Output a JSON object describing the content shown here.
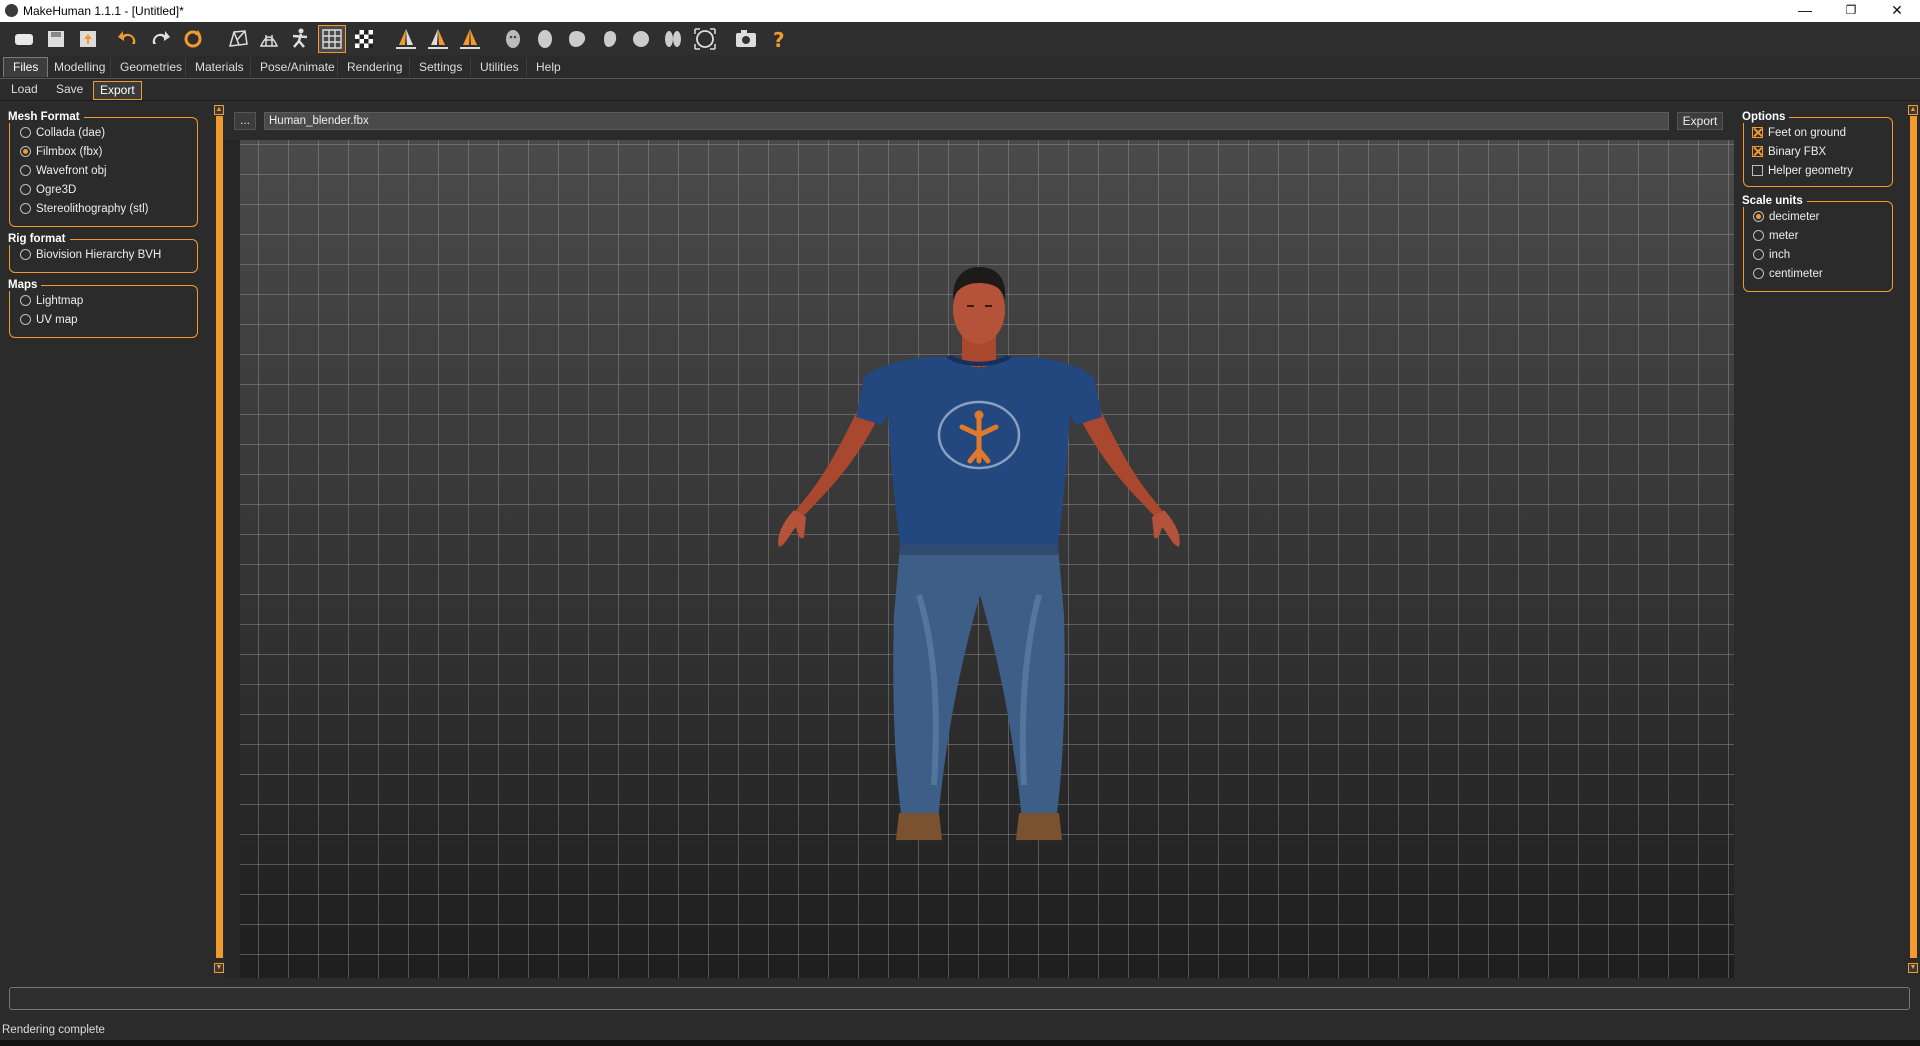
{
  "window": {
    "title": "MakeHuman 1.1.1 - [Untitled]*",
    "minimize": "—",
    "maximize": "❐",
    "close": "✕"
  },
  "toolbar": {
    "icons": [
      "new-file-icon",
      "save-file-icon",
      "export-file-icon",
      "undo-icon",
      "redo-icon",
      "reset-icon",
      "wireframe-icon",
      "smooth-icon",
      "pose-icon",
      "grid-icon",
      "checker-background-icon",
      "front-view-icon",
      "back-view-icon",
      "left-view-icon",
      "right-view-icon",
      "top-view-icon",
      "bottom-view-icon",
      "reset-camera-icon",
      "screenshot-icon",
      "help-icon"
    ]
  },
  "tabs": [
    "Files",
    "Modelling",
    "Geometries",
    "Materials",
    "Pose/Animate",
    "Rendering",
    "Settings",
    "Utilities",
    "Help"
  ],
  "subtabs": [
    "Load",
    "Save",
    "Export"
  ],
  "left": {
    "mesh_format": {
      "title": "Mesh Format",
      "options": [
        "Collada (dae)",
        "Filmbox (fbx)",
        "Wavefront obj",
        "Ogre3D",
        "Stereolithography (stl)"
      ],
      "selected": "Filmbox (fbx)"
    },
    "rig_format": {
      "title": "Rig format",
      "options": [
        "Biovision Hierarchy BVH"
      ]
    },
    "maps": {
      "title": "Maps",
      "options": [
        "Lightmap",
        "UV map"
      ]
    }
  },
  "filebar": {
    "browse_label": "...",
    "filename": "Human_blender.fbx",
    "export_label": "Export"
  },
  "right": {
    "options": {
      "title": "Options",
      "items": [
        {
          "label": "Feet on ground",
          "checked": true
        },
        {
          "label": "Binary FBX",
          "checked": true
        },
        {
          "label": "Helper geometry",
          "checked": false
        }
      ]
    },
    "scale_units": {
      "title": "Scale units",
      "options": [
        "decimeter",
        "meter",
        "inch",
        "centimeter"
      ],
      "selected": "decimeter"
    }
  },
  "status": {
    "text": "Rendering complete"
  },
  "colors": {
    "accent": "#f29a2e",
    "shirt": "#23477f",
    "jeans": "#3d5f87",
    "skin": "#b5523a"
  }
}
